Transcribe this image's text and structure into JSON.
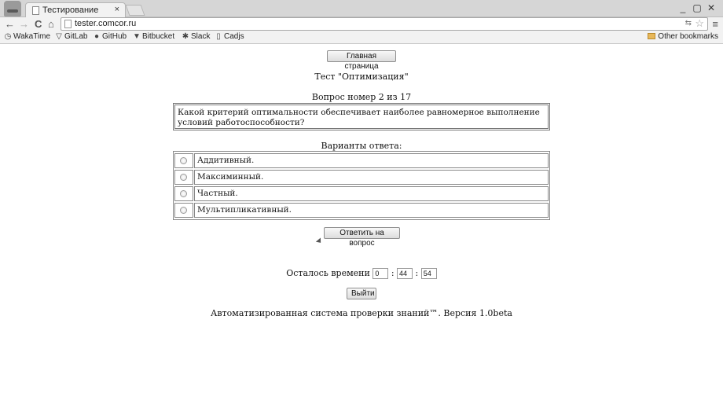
{
  "browser": {
    "tab_title": "Тестирование",
    "tab_close": "×",
    "url": "tester.comcor.ru",
    "nav": {
      "back": "←",
      "forward": "→",
      "reload": "C",
      "home": "⌂"
    },
    "window_controls": [
      "_",
      "▢",
      "✕"
    ],
    "bookmarks": [
      {
        "label": "WakaTime",
        "icon": "wakatime-icon",
        "glyph": "◷"
      },
      {
        "label": "GitLab",
        "icon": "gitlab-icon",
        "glyph": "▽"
      },
      {
        "label": "GitHub",
        "icon": "github-icon",
        "glyph": "●"
      },
      {
        "label": "Bitbucket",
        "icon": "bitbucket-icon",
        "glyph": "▼"
      },
      {
        "label": "Slack",
        "icon": "slack-icon",
        "glyph": "✱"
      },
      {
        "label": "Cadjs",
        "icon": "page-icon",
        "glyph": "▯"
      }
    ],
    "other_bookmarks": "Other bookmarks"
  },
  "page": {
    "home_button": "Главная страница",
    "test_title": "Тест \"Оптимизация\"",
    "question_number": "Вопрос номер 2 из 17",
    "question_text": "Какой критерий оптимальности обеспечивает наиболее равномерное выполнение условий работоспособности?",
    "answers_heading": "Варианты ответа:",
    "answers": [
      "Аддитивный.",
      "Максиминный.",
      "Частный.",
      "Мультипликативный."
    ],
    "submit_button": "Ответить на вопрос",
    "time_left_label": "Осталось времени",
    "timer": {
      "hours": "0",
      "minutes": "44",
      "seconds": "54",
      "separator": ":"
    },
    "exit_button": "Выйти",
    "footer": "Автоматизированная система проверки знаний™. Версия 1.0beta"
  }
}
